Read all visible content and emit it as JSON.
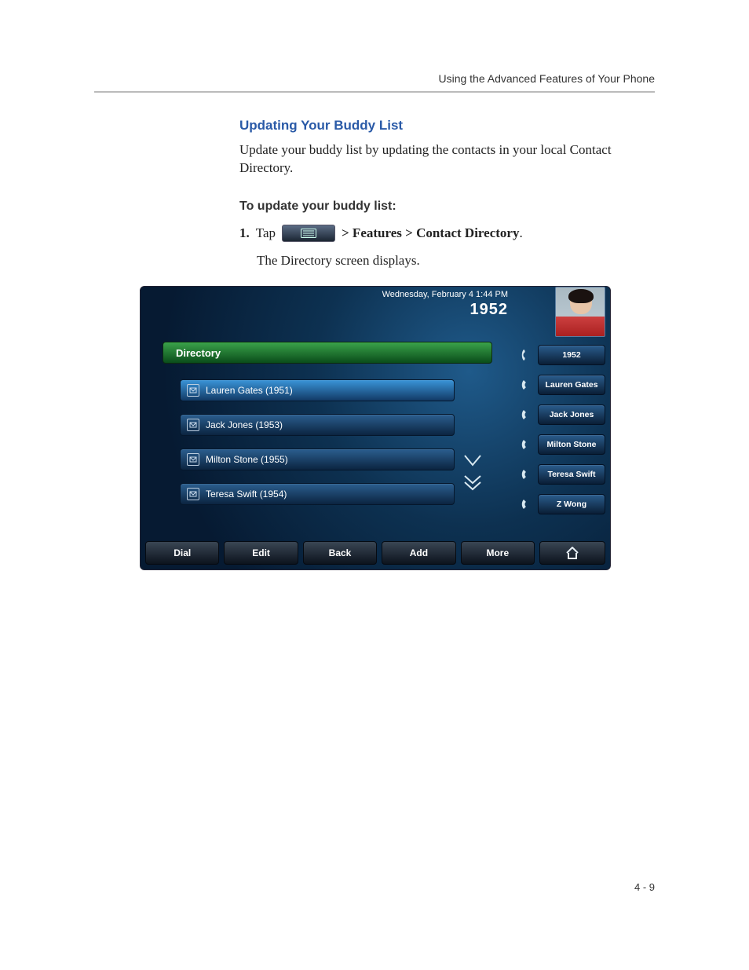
{
  "running_header": "Using the Advanced Features of Your Phone",
  "section_title": "Updating Your Buddy List",
  "intro_text": "Update your buddy list by updating the contacts in your local Contact Directory.",
  "subhead": "To update your buddy list:",
  "step1": {
    "number": "1.",
    "verb": "Tap",
    "path": "  > Features > Contact Directory",
    "trailing": ".",
    "result": "The Directory screen displays."
  },
  "phone": {
    "datetime": "Wednesday, February 4  1:44 PM",
    "extension": "1952",
    "dir_header": "Directory",
    "items": [
      {
        "label": "Lauren Gates (1951)",
        "selected": true
      },
      {
        "label": "Jack Jones (1953)",
        "selected": false
      },
      {
        "label": "Milton Stone (1955)",
        "selected": false
      },
      {
        "label": "Teresa Swift (1954)",
        "selected": false
      }
    ],
    "linekeys": [
      {
        "label": "1952"
      },
      {
        "label": "Lauren Gates"
      },
      {
        "label": "Jack Jones"
      },
      {
        "label": "Milton Stone"
      },
      {
        "label": "Teresa Swift"
      },
      {
        "label": "Z Wong"
      }
    ],
    "softkeys": [
      {
        "label": "Dial"
      },
      {
        "label": "Edit"
      },
      {
        "label": "Back"
      },
      {
        "label": "Add"
      },
      {
        "label": "More"
      }
    ]
  },
  "page_number": "4 - 9"
}
